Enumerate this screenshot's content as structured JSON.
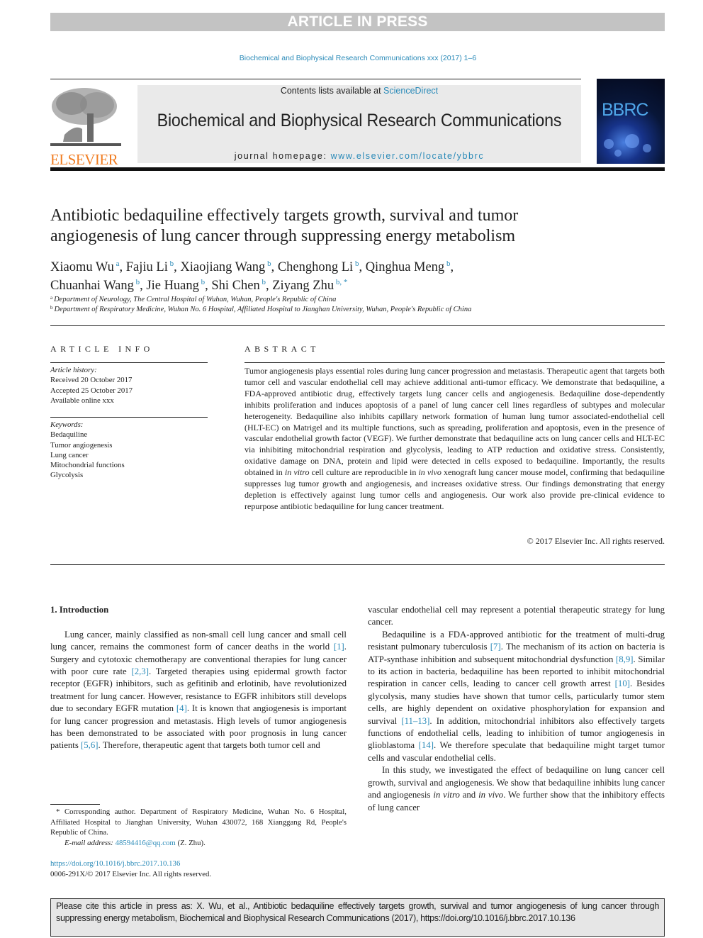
{
  "banner": "ARTICLE IN PRESS",
  "journal_ref": "Biochemical and Biophysical Research Communications xxx (2017) 1–6",
  "masthead": {
    "contents_prefix": "Contents lists available at ",
    "contents_link": "ScienceDirect",
    "journal_title": "Biochemical and Biophysical Research Communications",
    "homepage_prefix": "journal homepage: ",
    "homepage_link": "www.elsevier.com/locate/ybbrc",
    "publisher_logo_text": "ELSEVIER",
    "cover_text": "BBRC"
  },
  "colors": {
    "link": "#2a8ab8",
    "publisher_orange": "#f07c21",
    "banner_gray": "#c3c3c3"
  },
  "article": {
    "title": "Antibiotic bedaquiline effectively targets growth, survival and tumor angiogenesis of lung cancer through suppressing energy metabolism",
    "authors": [
      {
        "name": "Xiaomu Wu",
        "sup": "a"
      },
      {
        "name": "Fajiu Li",
        "sup": "b"
      },
      {
        "name": "Xiaojiang Wang",
        "sup": "b"
      },
      {
        "name": "Chenghong Li",
        "sup": "b"
      },
      {
        "name": "Qinghua Meng",
        "sup": "b"
      },
      {
        "name": "Chuanhai Wang",
        "sup": "b"
      },
      {
        "name": "Jie Huang",
        "sup": "b"
      },
      {
        "name": "Shi Chen",
        "sup": "b"
      },
      {
        "name": "Ziyang Zhu",
        "sup": "b, *"
      }
    ],
    "affiliations": [
      {
        "key": "a",
        "text": "Department of Neurology, The Central Hospital of Wuhan, Wuhan, People's Republic of China"
      },
      {
        "key": "b",
        "text": "Department of Respiratory Medicine, Wuhan No. 6 Hospital, Affiliated Hospital to Jianghan University, Wuhan, People's Republic of China"
      }
    ]
  },
  "article_info": {
    "caption": "ARTICLE INFO",
    "history_label": "Article history:",
    "history": [
      "Received 20 October 2017",
      "Accepted 25 October 2017",
      "Available online xxx"
    ],
    "keywords_label": "Keywords:",
    "keywords": [
      "Bedaquiline",
      "Tumor angiogenesis",
      "Lung cancer",
      "Mitochondrial functions",
      "Glycolysis"
    ]
  },
  "abstract": {
    "caption": "ABSTRACT",
    "text_1": "Tumor angiogenesis plays essential roles during lung cancer progression and metastasis. Therapeutic agent that targets both tumor cell and vascular endothelial cell may achieve additional anti-tumor efficacy. We demonstrate that bedaquiline, a FDA-approved antibiotic drug, effectively targets lung cancer cells and angiogenesis. Bedaquiline dose-dependently inhibits proliferation and induces apoptosis of a panel of lung cancer cell lines regardless of subtypes and molecular heterogeneity. Bedaquiline also inhibits capillary network formation of human lung tumor associated-endothelial cell (HLT-EC) on Matrigel and its multiple functions, such as spreading, proliferation and apoptosis, even in the presence of vascular endothelial growth factor (VEGF). We further demonstrate that bedaquiline acts on lung cancer cells and HLT-EC via inhibiting mitochondrial respiration and glycolysis, leading to ATP reduction and oxidative stress. Consistently, oxidative damage on DNA, protein and lipid were detected in cells exposed to bedaquiline. Importantly, the results obtained in ",
    "italic_1": "in vitro",
    "text_2": " cell culture are reproducible in ",
    "italic_2": "in vivo",
    "text_3": " xenograft lung cancer mouse model, confirming that bedaquiline suppresses lug tumor growth and angiogenesis, and increases oxidative stress. Our findings demonstrating that energy depletion is effectively against lung tumor cells and angiogenesis. Our work also provide pre-clinical evidence to repurpose antibiotic bedaquiline for lung cancer treatment.",
    "copyright": "© 2017 Elsevier Inc. All rights reserved."
  },
  "body": {
    "section_heading": "1.  Introduction",
    "left_p1": [
      {
        "t": "Lung cancer, mainly classified as non-small cell lung cancer and small cell lung cancer, remains the commonest form of cancer deaths in the world "
      },
      {
        "r": "[1]"
      },
      {
        "t": ". Surgery and cytotoxic chemotherapy are conventional therapies for lung cancer with poor cure rate "
      },
      {
        "r": "[2,3]"
      },
      {
        "t": ". Targeted therapies using epidermal growth factor receptor (EGFR) inhibitors, such as gefitinib and erlotinib, have revolutionized treatment for lung cancer. However, resistance to EGFR inhibitors still develops due to secondary EGFR mutation "
      },
      {
        "r": "[4]"
      },
      {
        "t": ". It is known that angiogenesis is important for lung cancer progression and metastasis. High levels of tumor angiogenesis has been demonstrated to be associated with poor prognosis in lung cancer patients "
      },
      {
        "r": "[5,6]"
      },
      {
        "t": ". Therefore, therapeutic agent that targets both tumor cell and"
      }
    ],
    "right_p1": "vascular endothelial cell may represent a potential therapeutic strategy for lung cancer.",
    "right_p2": [
      {
        "t": "Bedaquiline is a FDA-approved antibiotic for the treatment of multi-drug resistant pulmonary tuberculosis "
      },
      {
        "r": "[7]"
      },
      {
        "t": ". The mechanism of its action on bacteria is ATP-synthase inhibition and subsequent mitochondrial dysfunction "
      },
      {
        "r": "[8,9]"
      },
      {
        "t": ". Similar to its action in bacteria, bedaquiline has been reported to inhibit mitochondrial respiration in cancer cells, leading to cancer cell growth arrest "
      },
      {
        "r": "[10]"
      },
      {
        "t": ". Besides glycolysis, many studies have shown that tumor cells, particularly tumor stem cells, are highly dependent on oxidative phosphorylation for expansion and survival "
      },
      {
        "r": "[11–13]"
      },
      {
        "t": ". In addition, mitochondrial inhibitors also effectively targets functions of endothelial cells, leading to inhibition of tumor angiogenesis in glioblastoma "
      },
      {
        "r": "[14]"
      },
      {
        "t": ". We therefore speculate that bedaquiline might target tumor cells and vascular endothelial cells."
      }
    ],
    "right_p3": [
      {
        "t": "In this study, we investigated the effect of bedaquiline on lung cancer cell growth, survival and angiogenesis. We show that bedaquiline inhibits lung cancer and angiogenesis "
      },
      {
        "i": "in vitro"
      },
      {
        "t": " and "
      },
      {
        "i": "in vivo"
      },
      {
        "t": ". We further show that the inhibitory effects of lung cancer"
      }
    ]
  },
  "footnote": {
    "corresponding": "* Corresponding author. Department of Respiratory Medicine, Wuhan No. 6 Hospital, Affiliated Hospital to Jianghan University, Wuhan 430072, 168 Xianggang Rd, People's Republic of China.",
    "email_label": "E-mail address:",
    "email": "48594416@qq.com",
    "email_suffix": " (Z. Zhu).",
    "doi": "https://doi.org/10.1016/j.bbrc.2017.10.136",
    "issn": "0006-291X/© 2017 Elsevier Inc. All rights reserved."
  },
  "citation_box": "Please cite this article in press as: X. Wu, et al., Antibiotic bedaquiline effectively targets growth, survival and tumor angiogenesis of lung cancer through suppressing energy metabolism, Biochemical and Biophysical Research Communications (2017), https://doi.org/10.1016/j.bbrc.2017.10.136"
}
